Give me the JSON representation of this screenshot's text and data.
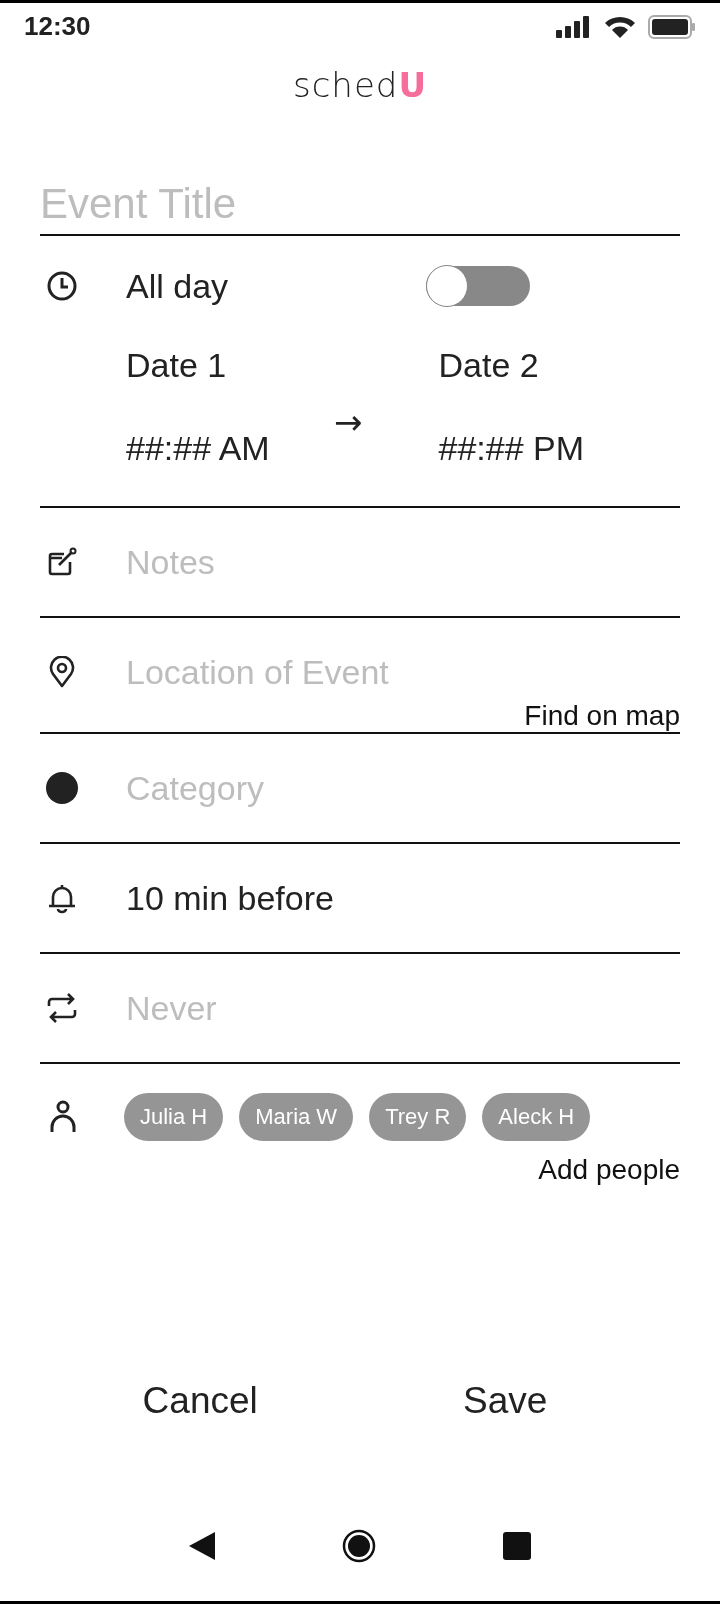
{
  "status_bar": {
    "time": "12:30"
  },
  "logo": {
    "text": "sched",
    "accent": "U"
  },
  "title_field": {
    "placeholder": "Event Title"
  },
  "all_day": {
    "label": "All day",
    "on": false
  },
  "start": {
    "date": "Date 1",
    "time": "##:## AM"
  },
  "arrow": "→",
  "end": {
    "date": "Date 2",
    "time": "##:## PM"
  },
  "fields": [
    {
      "kind": "notes",
      "placeholder": "Notes"
    },
    {
      "kind": "location",
      "placeholder": "Location of Event",
      "action": "Find on map"
    },
    {
      "kind": "category",
      "placeholder": "Category"
    },
    {
      "kind": "reminder",
      "value": "10 min before"
    },
    {
      "kind": "repeat",
      "placeholder": "Never"
    }
  ],
  "people": {
    "chips": [
      "Julia H",
      "Maria W",
      "Trey R",
      "Aleck H"
    ],
    "action": "Add people"
  },
  "buttons": {
    "cancel": "Cancel",
    "save": "Save"
  }
}
